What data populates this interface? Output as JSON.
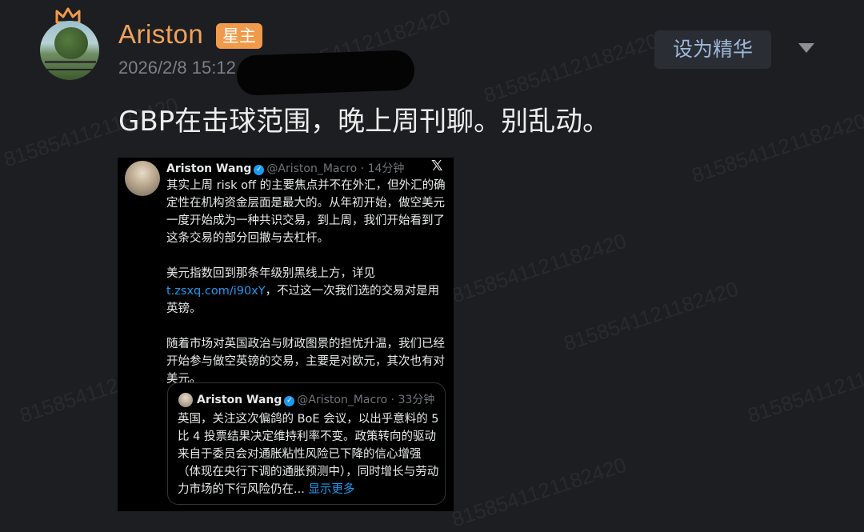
{
  "post": {
    "username": "Ariston",
    "badge": "星主",
    "timestamp": "2026/2/8 15:12",
    "set_featured_label": "设为精华",
    "text": "GBP在击球范围，晚上周刊聊。别乱动。"
  },
  "tweet": {
    "author_name": "Ariston Wang",
    "handle_time": "@Ariston_Macro · 14分钟",
    "para1": "其实上周 risk off 的主要焦点并不在外汇，但外汇的确定性在机构资金层面是最大的。从年初开始，做空美元一度开始成为一种共识交易，到上周，我们开始看到了这条交易的部分回撤与去杠杆。",
    "para2_prefix": "美元指数回到那条年级别黑线上方，详见",
    "link": "t.zsxq.com/i90xY",
    "para2_suffix": "，不过这一次我们选的交易对是用英镑。",
    "para3": "随着市场对英国政治与财政图景的担忧升温，我们已经开始参与做空英镑的交易，主要是对欧元，其次也有对美元。",
    "quote": {
      "author_name": "Ariston Wang",
      "handle_time": "@Ariston_Macro · 33分钟",
      "text": "英国，关注这次偏鸽的 BoE 会议，以出乎意料的 5 比 4 投票结果决定维持利率不变。政策转向的驱动来自于委员会对通胀粘性风险已下降的信心增强（体现在央行下调的通胀预测中），同时增长与劳动力市场的下行风险仍在...",
      "show_more": "显示更多"
    }
  },
  "watermark": "8158541121182420",
  "colors": {
    "background": "#1d1e22",
    "username": "#f0a25a",
    "badge": "#f09b4b",
    "link": "#1d9bf0"
  },
  "icons": [
    "crown-icon",
    "verified-icon",
    "x-logo-icon",
    "dropdown-caret-icon"
  ]
}
